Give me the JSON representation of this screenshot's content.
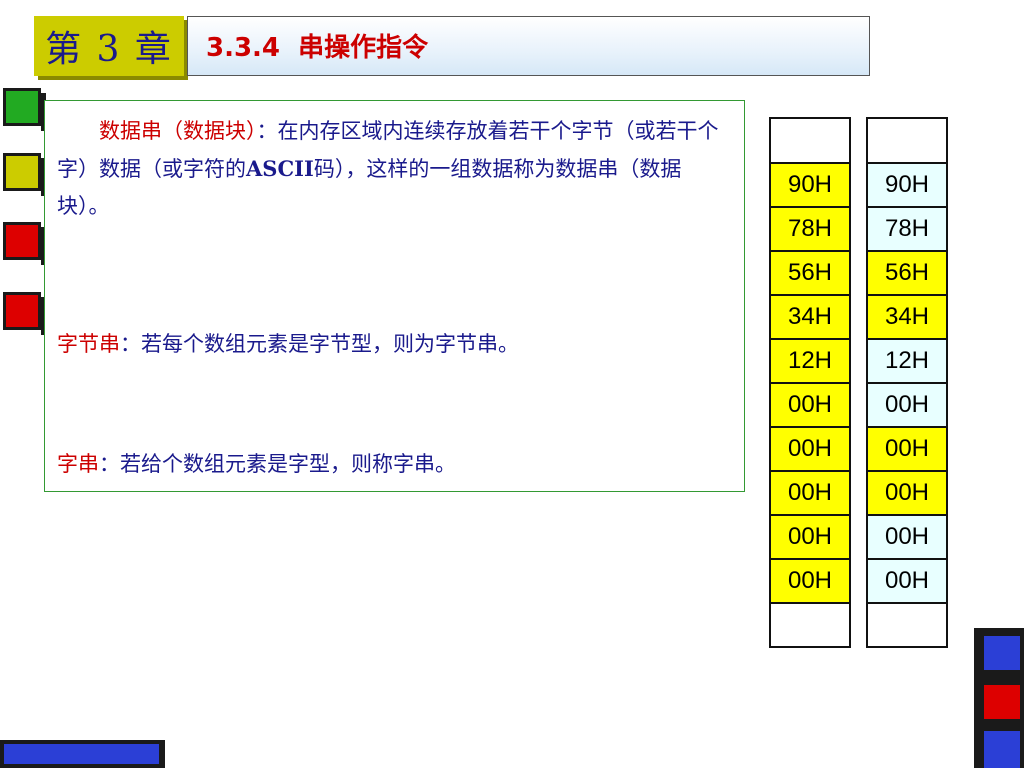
{
  "header": {
    "chapter": "第 3 章",
    "title": "3.3.4  串操作指令"
  },
  "content": {
    "p1_term": "数据串（数据块）",
    "p1_text_a": "：在内存区域内连续存放着若干个字节（或若干个字）数据（或字符的",
    "p1_ascii": "ASCII",
    "p1_text_b": "码），这样的一组数据称为数据串（数据块）。",
    "p2_term": "字节串",
    "p2_text": "：若每个数组元素是字节型，则为字节串。",
    "p3_term": "字串",
    "p3_text": "：若给个数组元素是字型，则称字串。"
  },
  "memory": {
    "byte_column": [
      "",
      "90H",
      "78H",
      "56H",
      "34H",
      "12H",
      "00H",
      "00H",
      "00H",
      "00H",
      "00H",
      ""
    ],
    "word_column": [
      "",
      "90H",
      "78H",
      "56H",
      "34H",
      "12H",
      "00H",
      "00H",
      "00H",
      "00H",
      "00H",
      ""
    ]
  },
  "colors": {
    "yellow_cell": "#ffff00",
    "cyan_cell": "#e8ffff",
    "title_red": "#cc0000",
    "text_blue": "#1a1a8c",
    "chapter_badge": "#cccc00"
  },
  "icons": {
    "nav_1": "green-square-icon",
    "nav_2": "yellow-square-icon",
    "nav_3": "red-square-icon",
    "nav_4": "red-square-icon"
  }
}
